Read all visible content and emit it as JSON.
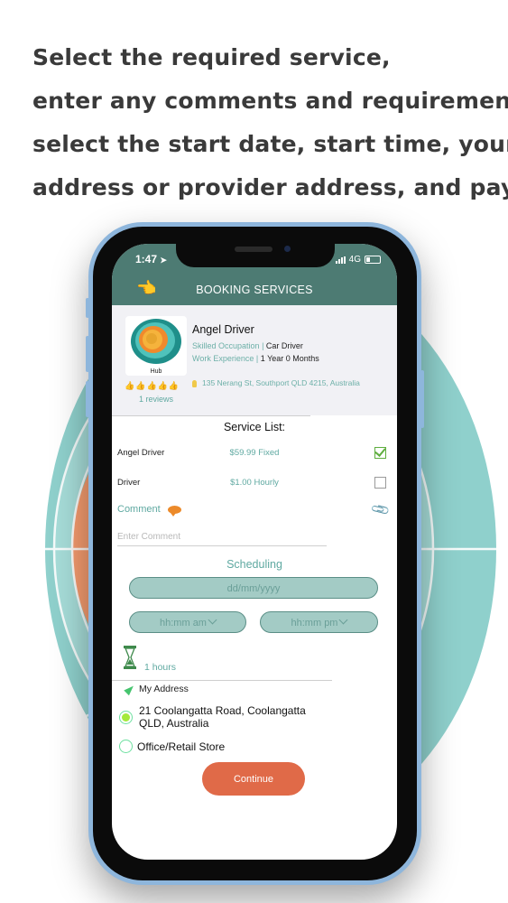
{
  "headline": {
    "lines": [
      "Select the required service,",
      "enter any comments and requirements,",
      "select the start date, start time, your",
      "address or provider address, and pay."
    ]
  },
  "colors": {
    "header_bg": "#4d7b73",
    "accent_teal": "#5fa9a1",
    "pill_bg": "#a3cbc5",
    "continue_bg": "#e06a48",
    "radio_selected": "#a4ea3a",
    "checkbox_checked": "#5fae3f"
  },
  "status_bar": {
    "time": "1:47",
    "location_icon": "location-arrow-icon",
    "network": "4G"
  },
  "nav": {
    "back_icon": "pointing-hand-icon",
    "title": "BOOKING SERVICES"
  },
  "provider": {
    "logo_caption": "Hub",
    "name": "Angel Driver",
    "occupation_label": "Skilled Occupation",
    "occupation_value": "Car Driver",
    "experience_label": "Work Experience",
    "experience_value": "1 Year 0 Months",
    "separator": "|",
    "address": "135 Nerang St, Southport QLD 4215, Australia",
    "rating_icons": 5,
    "reviews": "1 reviews"
  },
  "services": {
    "title": "Service List:",
    "items": [
      {
        "name": "Angel Driver",
        "price": "$59.99 Fixed",
        "checked": true
      },
      {
        "name": "Driver",
        "price": "$1.00 Hourly",
        "checked": false
      }
    ]
  },
  "comment": {
    "label": "Comment",
    "placeholder": "Enter Comment",
    "value": ""
  },
  "scheduling": {
    "title": "Scheduling",
    "date_placeholder": "dd/mm/yyyy",
    "start_time": "hh:mm am",
    "end_time": "hh:mm pm",
    "duration": "1 hours"
  },
  "address": {
    "title": "My Address",
    "options": [
      {
        "label": "21 Coolangatta Road, Coolangatta QLD, Australia",
        "line1": "21 Coolangatta Road, Coolangatta",
        "line2": "QLD, Australia",
        "selected": true
      },
      {
        "label": "Office/Retail Store",
        "selected": false
      }
    ]
  },
  "actions": {
    "continue_label": "Continue"
  }
}
